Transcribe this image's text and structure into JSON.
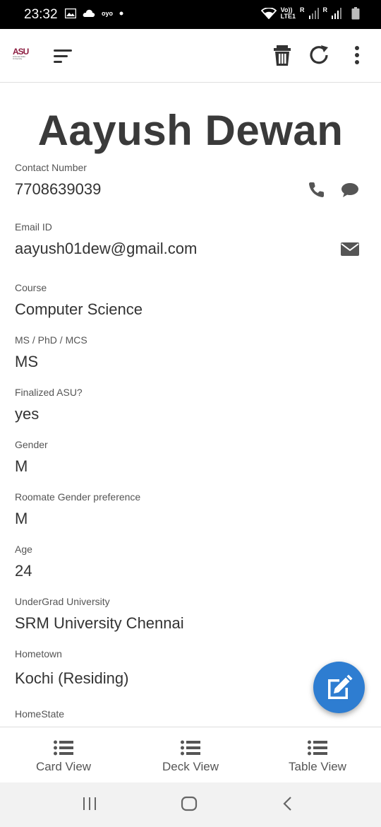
{
  "status_bar": {
    "time": "23:32",
    "left_icons": [
      "image-icon",
      "cloud-icon",
      "oyo-icon",
      "dot-icon"
    ],
    "oyo_text": "oyo",
    "network_text_top": "Vo))",
    "network_text_bottom": "LTE1",
    "sim_label_1": "R",
    "sim_label_2": "R"
  },
  "app_bar": {
    "logo_text": "ASU",
    "logo_sub": "Arizona State University",
    "actions": [
      "menu-icon",
      "delete-icon",
      "refresh-icon",
      "more-vert-icon"
    ]
  },
  "profile": {
    "name": "Aayush Dewan",
    "fields": [
      {
        "label": "Contact Number",
        "value": "7708639039"
      },
      {
        "label": "Email ID",
        "value": "aayush01dew@gmail.com"
      },
      {
        "label": "Course",
        "value": "Computer Science"
      },
      {
        "label": "MS / PhD / MCS",
        "value": "MS"
      },
      {
        "label": "Finalized ASU?",
        "value": "yes"
      },
      {
        "label": "Gender",
        "value": "M"
      },
      {
        "label": "Roomate Gender preference",
        "value": "M"
      },
      {
        "label": "Age",
        "value": "24"
      },
      {
        "label": "UnderGrad University",
        "value": "SRM University Chennai"
      },
      {
        "label": "Hometown",
        "value": "Kochi (Residing)"
      },
      {
        "label": "HomeState",
        "value": ""
      }
    ]
  },
  "bottom_nav": {
    "items": [
      {
        "label": "Card View",
        "icon": "list-icon"
      },
      {
        "label": "Deck View",
        "icon": "list-icon"
      },
      {
        "label": "Table View",
        "icon": "list-icon"
      }
    ]
  },
  "colors": {
    "accent": "#2e7dd1",
    "icon_gray": "#555555",
    "title": "#3a3a3a",
    "logo_maroon": "#8c1d40"
  }
}
